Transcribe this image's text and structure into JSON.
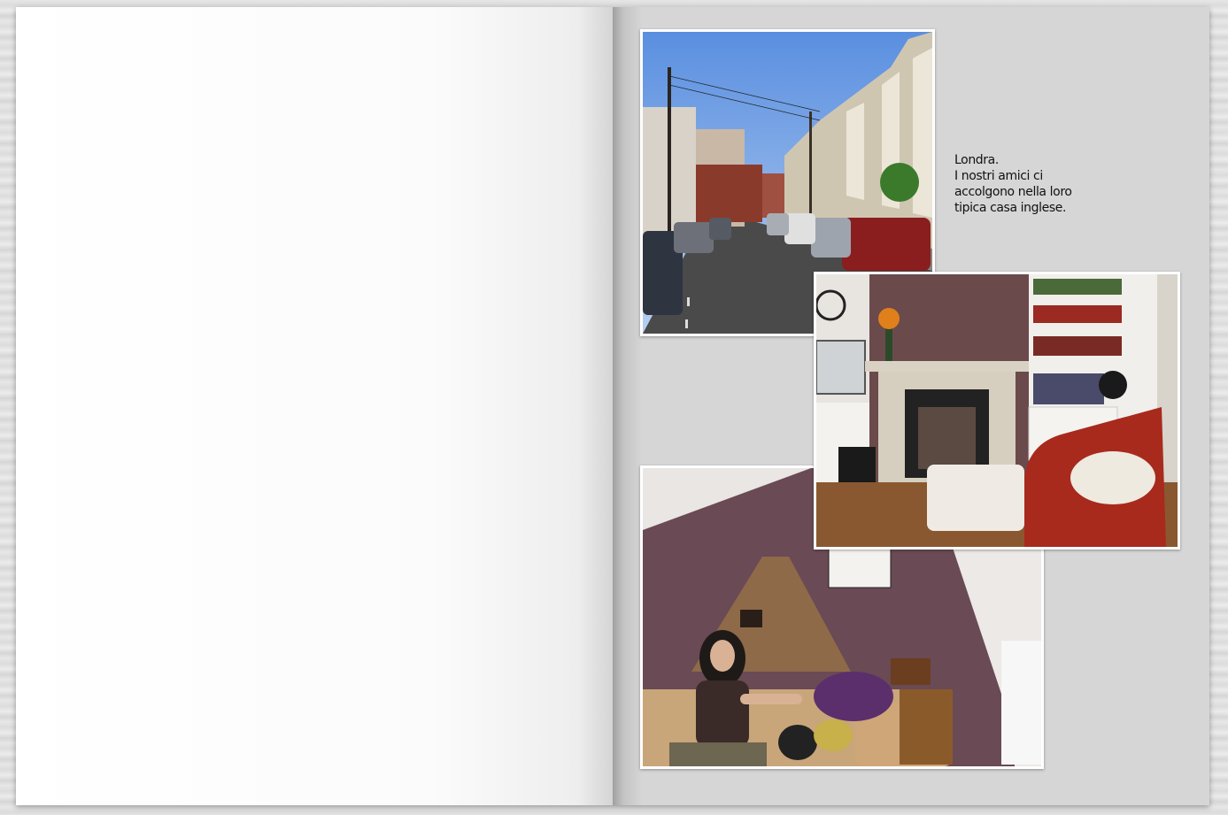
{
  "caption": {
    "line1": "Londra.",
    "line2": "I nostri amici ci",
    "line3": "accolgono nella loro",
    "line4": "tipica casa inglese."
  },
  "colors": {
    "page_left": "#ffffff",
    "page_right": "#d6d6d6",
    "photo_border": "#ffffff"
  }
}
